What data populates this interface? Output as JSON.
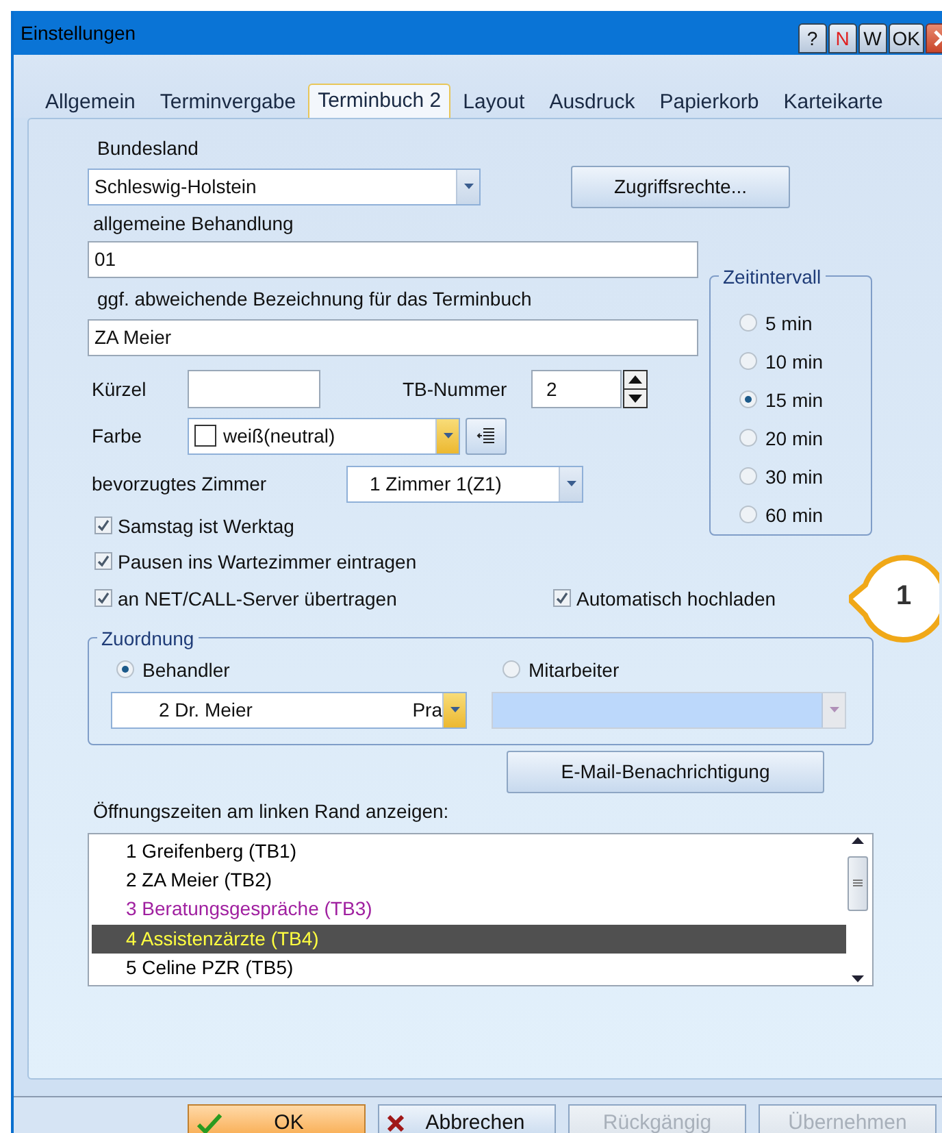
{
  "window": {
    "title": "Einstellungen",
    "title_buttons": [
      {
        "label": "?",
        "kind": "plain"
      },
      {
        "label": "N",
        "kind": "red"
      },
      {
        "label": "W",
        "kind": "plain"
      },
      {
        "label": "OK",
        "kind": "plain"
      }
    ]
  },
  "tabs": [
    {
      "label": "Allgemein",
      "selected": false
    },
    {
      "label": "Terminvergabe",
      "selected": false
    },
    {
      "label": "Terminbuch 2",
      "selected": true
    },
    {
      "label": "Layout",
      "selected": false
    },
    {
      "label": "Ausdruck",
      "selected": false
    },
    {
      "label": "Papierkorb",
      "selected": false
    },
    {
      "label": "Karteikarte",
      "selected": false
    }
  ],
  "bundesland": {
    "label": "Bundesland",
    "value": "Schleswig-Holstein"
  },
  "access_button": "Zugriffsrechte...",
  "general_treatment": {
    "label": "allgemeine Behandlung",
    "value": "01"
  },
  "alt_name": {
    "label": "ggf. abweichende Bezeichnung für das Terminbuch",
    "value": "ZA Meier"
  },
  "short_name": {
    "label": "Kürzel"
  },
  "tb_number": {
    "label": "TB-Nummer",
    "value": "2"
  },
  "color": {
    "label": "Farbe",
    "value": "weiß(neutral)"
  },
  "room": {
    "label": "bevorzugtes Zimmer",
    "value": "1 Zimmer 1(Z1)"
  },
  "options": [
    {
      "label": "Samstag ist Werktag",
      "checked": true
    },
    {
      "label": "Pausen ins Wartezimmer eintragen",
      "checked": true
    }
  ],
  "server_option": {
    "label": "an NET/CALL-Server übertragen",
    "checked": true
  },
  "upload_option": {
    "label": "Automatisch hochladen",
    "checked": true
  },
  "interval": {
    "title": "Zeitintervall",
    "options": [
      {
        "label": "5 min",
        "selected": false
      },
      {
        "label": "10 min",
        "selected": false
      },
      {
        "label": "15 min",
        "selected": true
      },
      {
        "label": "20 min",
        "selected": false
      },
      {
        "label": "30 min",
        "selected": false
      },
      {
        "label": "60 min",
        "selected": false
      }
    ]
  },
  "assignment": {
    "title": "Zuordnung",
    "options": [
      {
        "label": "Behandler",
        "selected": true
      },
      {
        "label": "Mitarbeiter",
        "selected": false
      }
    ],
    "practitioner": "2 Dr. Meier",
    "practitioner_extra": "Pra"
  },
  "email_button": "E-Mail-Benachrichtigung",
  "hours": {
    "label": "Öffnungszeiten am linken Rand anzeigen:",
    "items": [
      {
        "label": "1 Greifenberg (TB1)",
        "color": "#000000",
        "selected": false
      },
      {
        "label": "2 ZA Meier (TB2)",
        "color": "#000000",
        "selected": false
      },
      {
        "label": "3 Beratungsgespräche (TB3)",
        "color": "#a020a0",
        "selected": false
      },
      {
        "label": "4 Assistenzärzte (TB4)",
        "color": "#ffff40",
        "selected": true
      },
      {
        "label": "5 Celine PZR (TB5)",
        "color": "#000000",
        "selected": false
      }
    ]
  },
  "buttons": [
    {
      "label": "OK",
      "kind": "ok",
      "disabled": false
    },
    {
      "label": "Abbrechen",
      "kind": "cancel",
      "disabled": false
    },
    {
      "label": "Rückgängig",
      "kind": "plain",
      "disabled": true
    },
    {
      "label": "Übernehmen",
      "kind": "plain",
      "disabled": true
    }
  ],
  "callout": "1"
}
